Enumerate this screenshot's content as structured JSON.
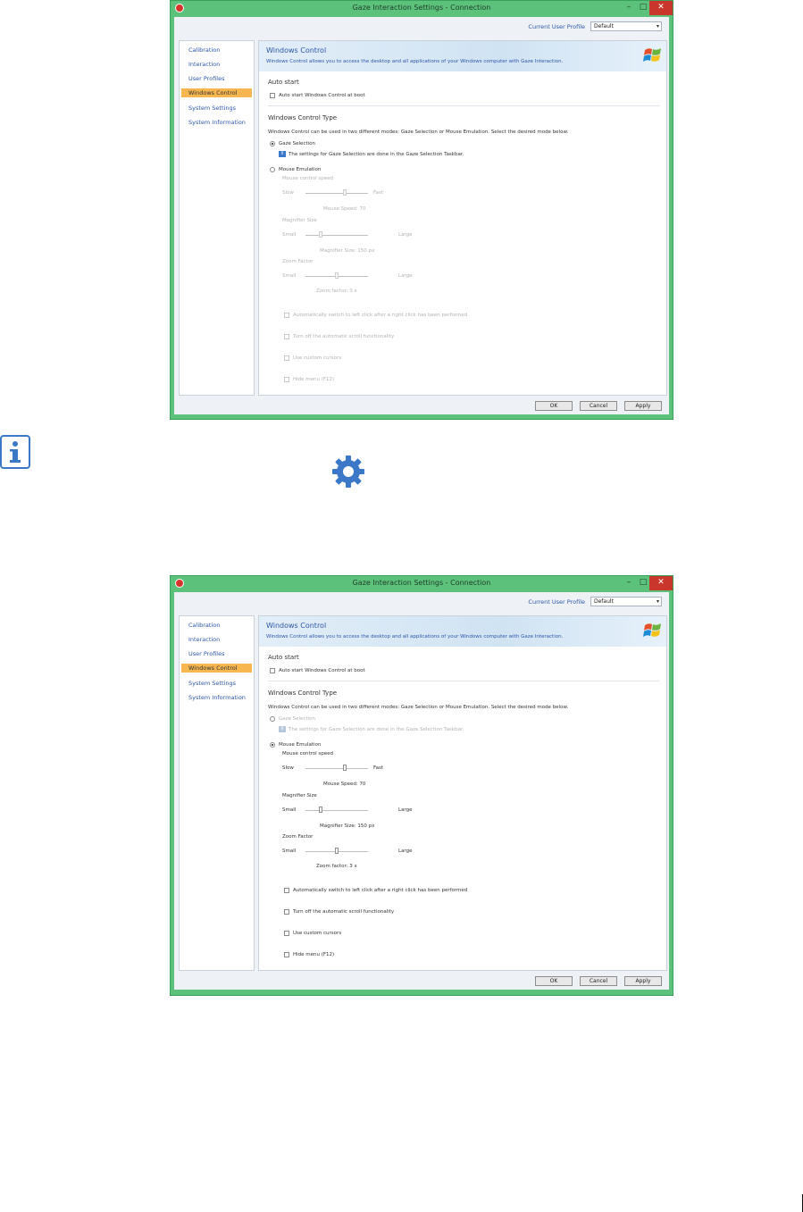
{
  "window": {
    "title": "Gaze Interaction Settings - Connection",
    "minimize": "–",
    "maximize": "□",
    "close": "✕"
  },
  "profile": {
    "label": "Current User Profile",
    "value": "Default"
  },
  "sidebar": {
    "items": [
      {
        "label": "Calibration"
      },
      {
        "label": "Interaction"
      },
      {
        "label": "User Profiles"
      },
      {
        "label": "Windows Control"
      },
      {
        "label": "System Settings"
      },
      {
        "label": "System Information"
      }
    ],
    "active_index": 3
  },
  "main": {
    "title": "Windows Control",
    "description": "Windows Control allows you to access the desktop and all applications of your Windows computer with Gaze Interaction.",
    "autostart": {
      "heading": "Auto start",
      "checkbox_label": "Auto start Windows Control at boot"
    },
    "control_type": {
      "heading": "Windows Control Type",
      "description": "Windows Control can be used in two different modes: Gaze Selection or Mouse Emulation. Select the desired mode below.",
      "gaze_selection_label": "Gaze Selection",
      "gaze_info_text": "The settings for Gaze Selection are done in the Gaze Selection Taskbar.",
      "mouse_emulation_label": "Mouse Emulation"
    },
    "mouse": {
      "speed_label": "Mouse control speed",
      "speed_min": "Slow",
      "speed_max": "Fast",
      "speed_value": "Mouse Speed: 70",
      "speed_level": 0.7,
      "magnifier_label": "Magnifier Size",
      "magnifier_min": "Small",
      "magnifier_max": "Large",
      "magnifier_value": "Magnifier Size: 150 px",
      "magnifier_level": 0.25,
      "zoom_label": "Zoom Factor",
      "zoom_min": "Small",
      "zoom_max": "Large",
      "zoom_value": "Zoom factor: 3 x",
      "zoom_level": 0.5
    },
    "options": [
      {
        "label": "Automatically switch to left click after a right click has been performed"
      },
      {
        "label": "Turn off the automatic scroll functionality"
      },
      {
        "label": "Use custom cursors"
      },
      {
        "label": "Hide menu (F12)"
      }
    ]
  },
  "buttons": {
    "ok": "OK",
    "cancel": "Cancel",
    "apply": "Apply"
  },
  "screens": [
    {
      "name": "gaze-selection-mode",
      "selected_mode": "gaze"
    },
    {
      "name": "mouse-emulation-mode",
      "selected_mode": "mouse"
    }
  ],
  "colors": {
    "window_frame": "#5cc17b",
    "link_blue": "#2d56a8",
    "active_nav": "#f7b64f",
    "close_red": "#c9362b",
    "icon_blue": "#3b78c7"
  },
  "icons": {
    "info": "info-icon",
    "settings": "gear-icon"
  }
}
